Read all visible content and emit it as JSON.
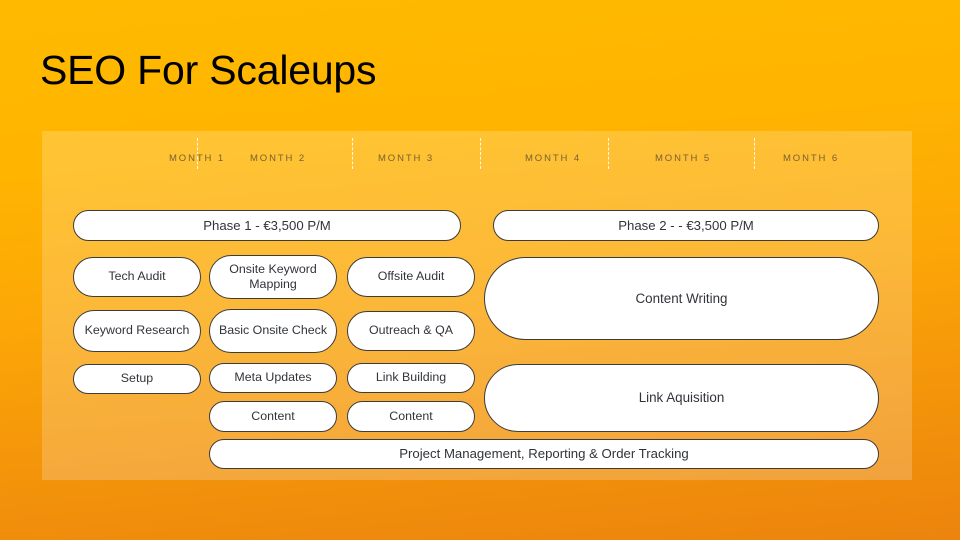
{
  "slide": {
    "title": "SEO For Scaleups",
    "background_top_color": "#FFBA00",
    "background_bottom_color": "#EC840D",
    "panel_tint": "rgba(255,255,255,0.20)"
  },
  "timeline": {
    "months": [
      {
        "label": "MONTH 1"
      },
      {
        "label": "MONTH 2"
      },
      {
        "label": "MONTH 3"
      },
      {
        "label": "MONTH 4"
      },
      {
        "label": "MONTH 5"
      },
      {
        "label": "MONTH 6"
      }
    ],
    "divider_color": "#FFFFFF"
  },
  "phases": [
    {
      "label": "Phase 1 - €3,500 P/M"
    },
    {
      "label": "Phase 2 -  - €3,500 P/M"
    }
  ],
  "columns": [
    {
      "name": "month-1",
      "tasks": [
        {
          "label": "Tech Audit"
        },
        {
          "label": "Keyword Research"
        },
        {
          "label": "Setup"
        }
      ]
    },
    {
      "name": "month-2",
      "tasks": [
        {
          "label": "Onsite Keyword Mapping"
        },
        {
          "label": "Basic Onsite Check"
        },
        {
          "label": "Meta Updates"
        },
        {
          "label": "Content"
        }
      ]
    },
    {
      "name": "month-3",
      "tasks": [
        {
          "label": "Offsite Audit"
        },
        {
          "label": "Outreach & QA"
        },
        {
          "label": "Link Building"
        },
        {
          "label": "Content"
        }
      ]
    }
  ],
  "phase2_blocks": [
    {
      "label": "Content Writing"
    },
    {
      "label": "Link Aquisition"
    }
  ],
  "footer": {
    "label": "Project Management, Reporting & Order Tracking"
  },
  "pill_style": {
    "fill": "#FFFFFF",
    "border": "#3C3C3C",
    "text": "#31343A"
  }
}
